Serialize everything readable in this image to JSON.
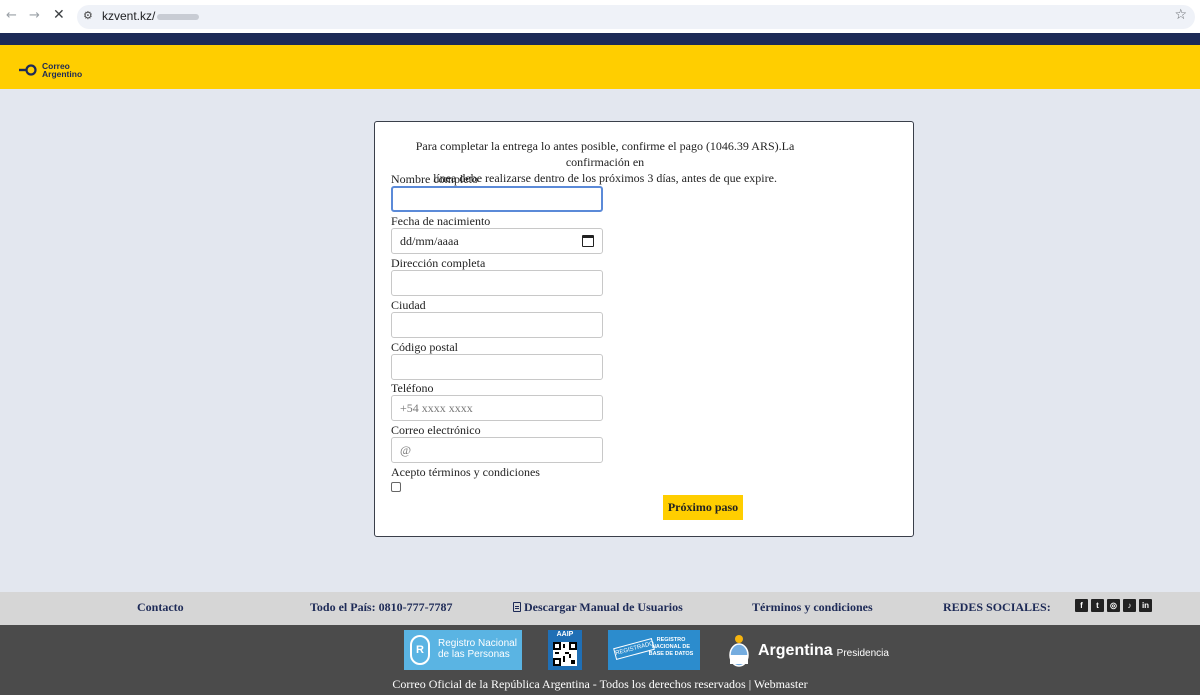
{
  "browser": {
    "back_glyph": "←",
    "forward_glyph": "→",
    "stop_glyph": "✕",
    "url": "kzvent.kz/",
    "star_glyph": "☆"
  },
  "header": {
    "logo_line1": "Correo",
    "logo_line2": "Argentino",
    "brand_color": "#ffce00",
    "navy_color": "#1d2a57"
  },
  "form": {
    "intro_line1": "Para completar la entrega lo antes posible, confirme el pago (1046.39 ARS).La confirmación en",
    "intro_line2": "línea debe realizarse dentro de los próximos 3 días, antes de que expire.",
    "fields": [
      {
        "label": "Nombre completo",
        "value": "",
        "placeholder": ""
      },
      {
        "label": "Fecha de nacimiento",
        "value": "dd/mm/aaaa",
        "placeholder": ""
      },
      {
        "label": "Dirección completa",
        "value": "",
        "placeholder": ""
      },
      {
        "label": "Ciudad",
        "value": "",
        "placeholder": ""
      },
      {
        "label": "Código postal",
        "value": "",
        "placeholder": ""
      },
      {
        "label": "Teléfono",
        "value": "",
        "placeholder": "+54 xxxx xxxx"
      },
      {
        "label": "Correo electrónico",
        "value": "",
        "placeholder": "@"
      }
    ],
    "terms_label": "Acepto términos y condiciones",
    "submit_label": "Próximo paso"
  },
  "footer": {
    "contact": "Contacto",
    "phone": "Todo el País: 0810-777-7787",
    "manual": "Descargar Manual de Usuarios",
    "terms": "Términos y condiciones",
    "social_label": "REDES SOCIALES:",
    "socials": [
      {
        "name": "facebook-icon",
        "glyph": "f"
      },
      {
        "name": "twitter-icon",
        "glyph": "t"
      },
      {
        "name": "instagram-icon",
        "glyph": "◎"
      },
      {
        "name": "tiktok-icon",
        "glyph": "♪"
      },
      {
        "name": "linkedin-icon",
        "glyph": "in"
      }
    ],
    "rnp_seal": "R",
    "rnp_line1": "Registro Nacional",
    "rnp_line2": "de las Personas",
    "aaip_label": "AAIP",
    "reg_stamp": "REGISTRADO",
    "reg_text": "REGISTRO NACIONAL DE BASE DE DATOS",
    "arg_word": "Argentina",
    "arg_sub": "Presidencia",
    "copyright": "Correo Oficial de la República Argentina - Todos los derechos reservados | Webmaster"
  }
}
